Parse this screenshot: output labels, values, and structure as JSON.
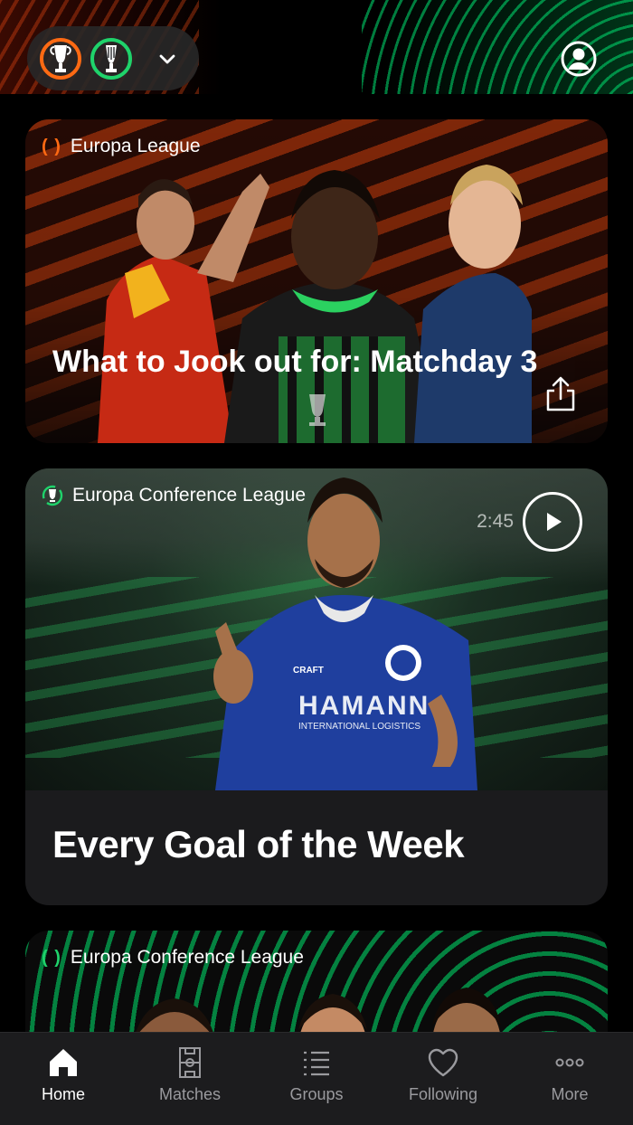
{
  "header": {
    "competitions": [
      "Europa League",
      "Europa Conference League"
    ],
    "switcher_icon": "chevron-down-icon",
    "account_icon": "user-circle-icon"
  },
  "feed": [
    {
      "competition": "Europa League",
      "title": "What to Jook out for: Matchday 3",
      "action_icon": "share-icon",
      "accent": "#ff6a13"
    },
    {
      "competition": "Europa Conference League",
      "duration": "2:45",
      "title": "Every Goal of the Week",
      "action_icon": "play-icon",
      "accent": "#1fd36b"
    },
    {
      "competition": "Europa Conference League",
      "accent": "#1fd36b"
    }
  ],
  "tabbar": {
    "items": [
      {
        "label": "Home",
        "icon": "home-icon",
        "active": true
      },
      {
        "label": "Matches",
        "icon": "pitch-icon",
        "active": false
      },
      {
        "label": "Groups",
        "icon": "list-icon",
        "active": false
      },
      {
        "label": "Following",
        "icon": "heart-icon",
        "active": false
      },
      {
        "label": "More",
        "icon": "more-icon",
        "active": false
      }
    ]
  },
  "colors": {
    "background": "#000000",
    "card": "#1b1b1d",
    "tabbar": "#1c1c1e",
    "europa_orange": "#ff6a13",
    "conference_green": "#1fd36b"
  }
}
